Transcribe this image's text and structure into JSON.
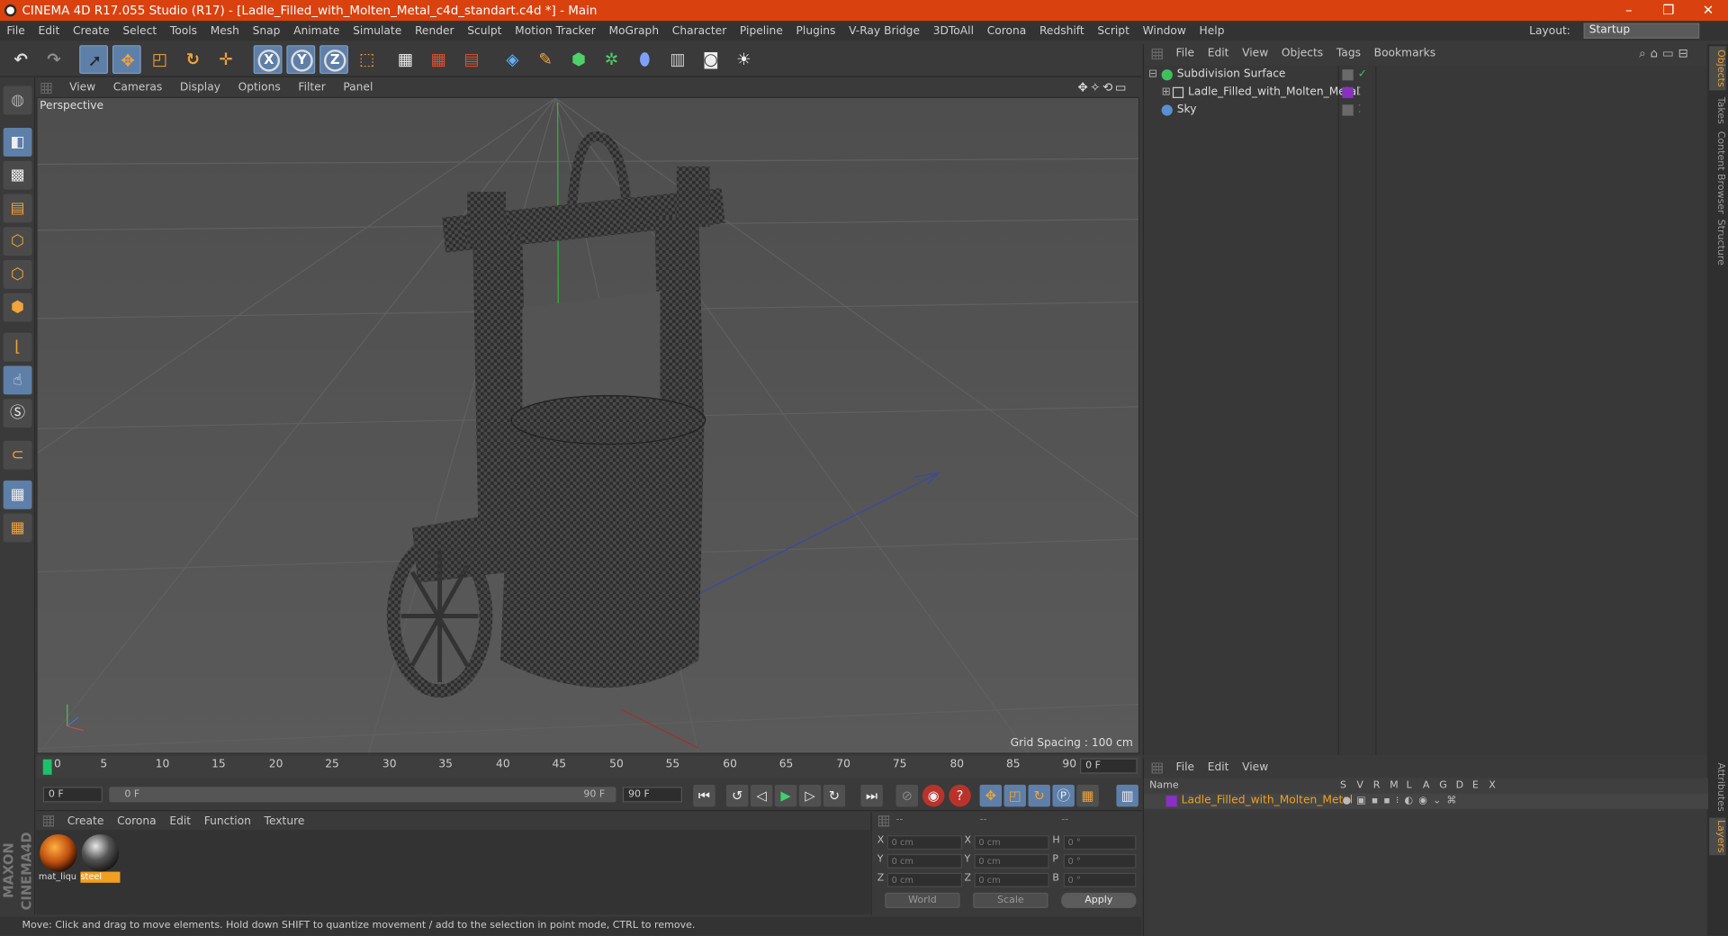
{
  "window": {
    "title": "CINEMA 4D R17.055 Studio (R17) - [Ladle_Filled_with_Molten_Metal_c4d_standart.c4d *] - Main",
    "minimize": "–",
    "restore": "❐",
    "close": "✕"
  },
  "menubar": {
    "items": [
      "File",
      "Edit",
      "Create",
      "Select",
      "Tools",
      "Mesh",
      "Snap",
      "Animate",
      "Simulate",
      "Render",
      "Sculpt",
      "Motion Tracker",
      "MoGraph",
      "Character",
      "Pipeline",
      "Plugins",
      "V-Ray Bridge",
      "3DToAll",
      "Corona",
      "Redshift",
      "Script",
      "Window",
      "Help"
    ],
    "layout_label": "Layout:",
    "layout_value": "Startup"
  },
  "toolbar": {
    "icons": [
      "undo-icon",
      "redo-icon",
      "select-arrow-icon",
      "move-icon",
      "scale-icon",
      "rotate-icon",
      "live-select-icon",
      "x-axis-lock-icon",
      "y-axis-lock-icon",
      "z-axis-lock-icon",
      "coordinate-system-icon",
      "render-view-icon",
      "render-picture-viewer-icon",
      "render-settings-icon",
      "cube-primitive-icon",
      "pen-spline-icon",
      "subdivision-generator-icon",
      "cloner-icon",
      "deformer-icon",
      "floor-scene-icon",
      "camera-icon",
      "light-icon"
    ],
    "axis_x": "X",
    "axis_y": "Y",
    "axis_z": "Z"
  },
  "viewport": {
    "menu": [
      "View",
      "Cameras",
      "Display",
      "Options",
      "Filter",
      "Panel"
    ],
    "label": "Perspective",
    "grid_spacing": "Grid Spacing : 100 cm"
  },
  "timeline": {
    "ticks": [
      "0",
      "5",
      "10",
      "15",
      "20",
      "25",
      "30",
      "35",
      "40",
      "45",
      "50",
      "55",
      "60",
      "65",
      "70",
      "75",
      "80",
      "85",
      "90"
    ],
    "current_frame": "0 F"
  },
  "transport": {
    "start_field": "0 F",
    "range_start": "0 F",
    "range_end": "90 F",
    "end_field": "90 F"
  },
  "materials": {
    "menu": [
      "Create",
      "Corona",
      "Edit",
      "Function",
      "Texture"
    ],
    "items": [
      {
        "label": "mat_liqu",
        "selected": false
      },
      {
        "label": "steel",
        "selected": true
      }
    ]
  },
  "coordinates": {
    "header": [
      "--",
      "--",
      "--"
    ],
    "rows": [
      {
        "a": "X",
        "v1": "0 cm",
        "b": "X",
        "v2": "0 cm",
        "c": "H",
        "v3": "0 °"
      },
      {
        "a": "Y",
        "v1": "0 cm",
        "b": "Y",
        "v2": "0 cm",
        "c": "P",
        "v3": "0 °"
      },
      {
        "a": "Z",
        "v1": "0 cm",
        "b": "Z",
        "v2": "0 cm",
        "c": "B",
        "v3": "0 °"
      }
    ],
    "world": "World",
    "scale": "Scale",
    "apply": "Apply"
  },
  "status": "Move: Click and drag to move elements. Hold down SHIFT to quantize movement / add to the selection in point mode, CTRL to remove.",
  "object_manager": {
    "menu": [
      "File",
      "Edit",
      "View",
      "Objects",
      "Tags",
      "Bookmarks"
    ],
    "objects": [
      {
        "name": "Subdivision Surface"
      },
      {
        "name": "Ladle_Filled_with_Molten_Metal"
      },
      {
        "name": "Sky"
      }
    ]
  },
  "right_tabs": [
    "Objects",
    "Takes",
    "Content Browser",
    "Structure",
    "Attributes",
    "Layers"
  ],
  "layer_manager": {
    "menu": [
      "File",
      "Edit",
      "View"
    ],
    "columns": [
      "Name",
      "S",
      "V",
      "R",
      "M",
      "L",
      "A",
      "G",
      "D",
      "E",
      "X"
    ],
    "layers": [
      {
        "name": "Ladle_Filled_with_Molten_Metal"
      }
    ]
  },
  "colors": {
    "titlebar": "#d9420f",
    "selected_material": "#f0a020",
    "layer_name": "#f0a020",
    "accent_blue": "#5e7fa8"
  }
}
